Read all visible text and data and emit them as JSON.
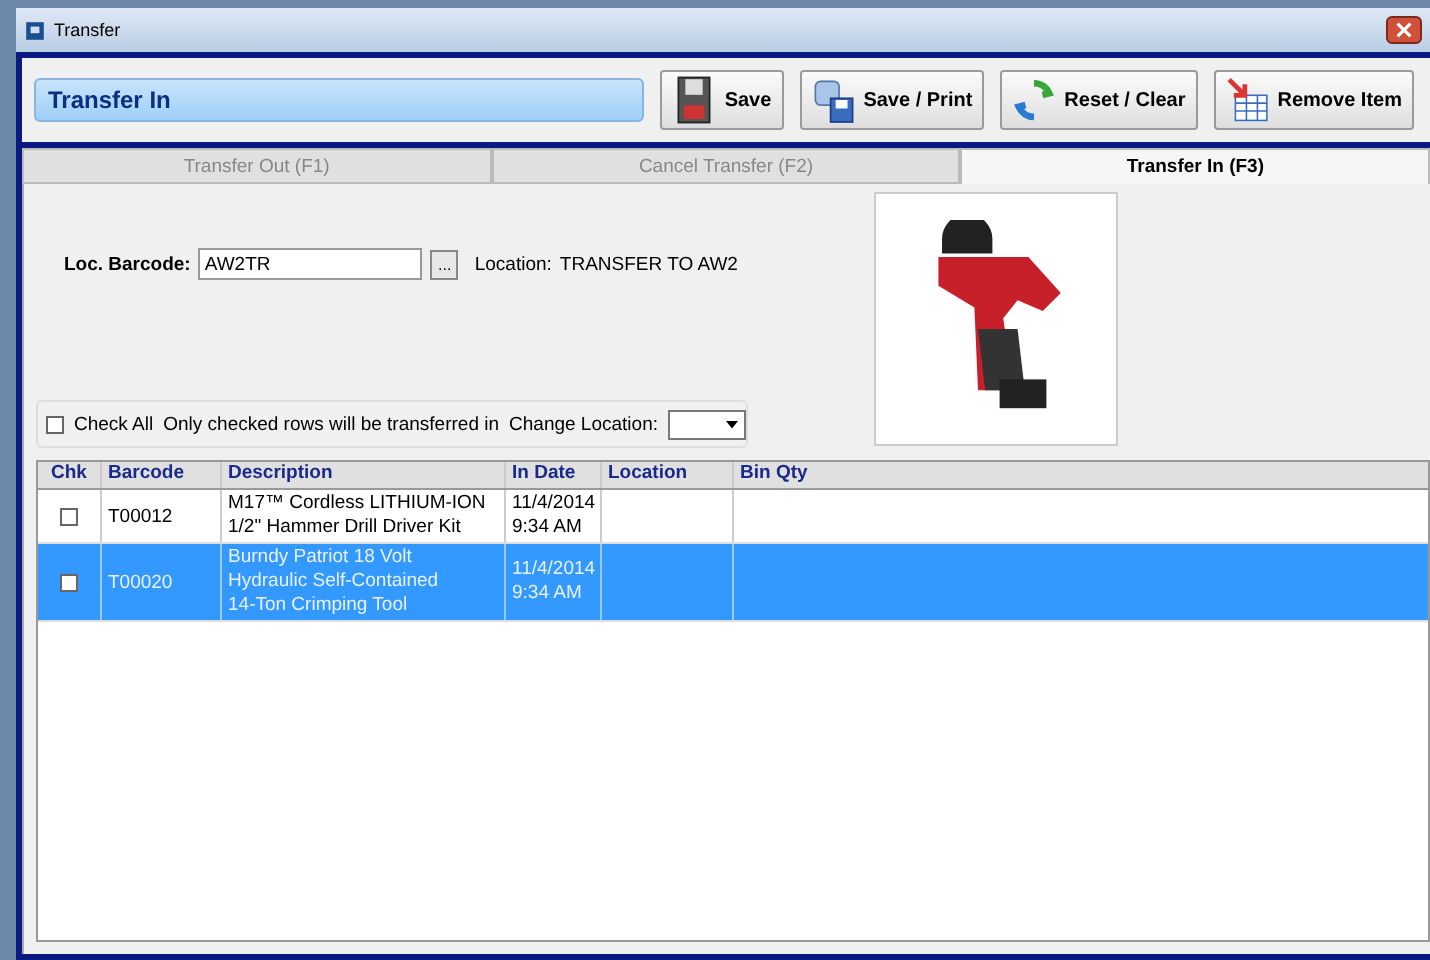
{
  "window": {
    "title": "Transfer"
  },
  "header": {
    "title": "Transfer In"
  },
  "buttons": [
    {
      "label": "Save",
      "kind": "save"
    },
    {
      "label": "Save / Print",
      "kind": "print"
    },
    {
      "label": "Reset / Clear",
      "kind": "reset"
    },
    {
      "label": "Remove Item",
      "kind": "remove"
    }
  ],
  "tabs": [
    {
      "label": "Transfer Out (F1)",
      "selected": false
    },
    {
      "label": "Cancel Transfer (F2)",
      "selected": false
    },
    {
      "label": "Transfer In (F3)",
      "selected": true
    }
  ],
  "loc_barcode": {
    "label": "Loc. Barcode:",
    "value": "AW2TR",
    "browse": "...",
    "location_label": "Location:",
    "location_value": "TRANSFER TO AW2"
  },
  "options": {
    "check_all": {
      "label": "Check All",
      "checked": false
    },
    "note": "Only checked rows will be transferred in",
    "change_location": {
      "label": "Change Location:"
    }
  },
  "table": {
    "columns": [
      "Chk",
      "Barcode",
      "Description",
      "In Date",
      "Location",
      "Bin Qty"
    ],
    "rows": [
      {
        "checked": false,
        "selected": false,
        "barcode": "T00012",
        "description": "M17™ Cordless LITHIUM-ION\n1/2\" Hammer Drill Driver Kit",
        "in_date": "11/4/2014\n9:34 AM"
      },
      {
        "checked": false,
        "selected": true,
        "barcode": "T00020",
        "description": "Burndy Patriot 18 Volt\nHydraulic Self-Contained\n14-Ton Crimping Tool",
        "in_date": "11/4/2014\n9:34 AM"
      }
    ]
  }
}
